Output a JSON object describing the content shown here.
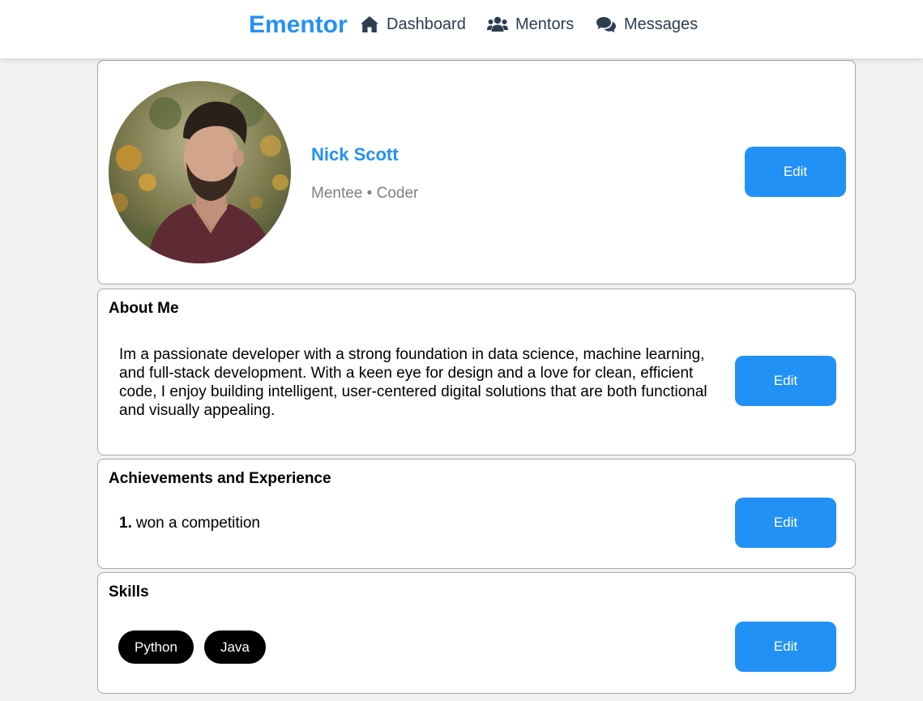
{
  "nav": {
    "brand": "Ementor",
    "links": [
      {
        "label": "Dashboard",
        "icon": "home-icon"
      },
      {
        "label": "Mentors",
        "icon": "users-icon"
      },
      {
        "label": "Messages",
        "icon": "chat-icon"
      }
    ]
  },
  "profile": {
    "name": "Nick Scott",
    "subtitle": "Mentee • Coder",
    "edit_label": "Edit"
  },
  "about": {
    "title": "About Me",
    "text": "Im a passionate developer with a strong foundation in data science, machine learning, and full-stack development. With a keen eye for design and a love for clean, efficient code, I enjoy building intelligent, user-centered digital solutions that are both functional and visually appealing.",
    "edit_label": "Edit"
  },
  "achievements": {
    "title": "Achievements and Experience",
    "items": [
      {
        "number": "1.",
        "text": "won a competition"
      }
    ],
    "edit_label": "Edit"
  },
  "skills": {
    "title": "Skills",
    "items": [
      "Python",
      "Java"
    ],
    "edit_label": "Edit"
  },
  "colors": {
    "accent": "#2291f5",
    "nav_text": "#2c3e50",
    "subtitle": "#808080",
    "chip_bg": "#000000",
    "page_bg": "#f0f1f3"
  }
}
